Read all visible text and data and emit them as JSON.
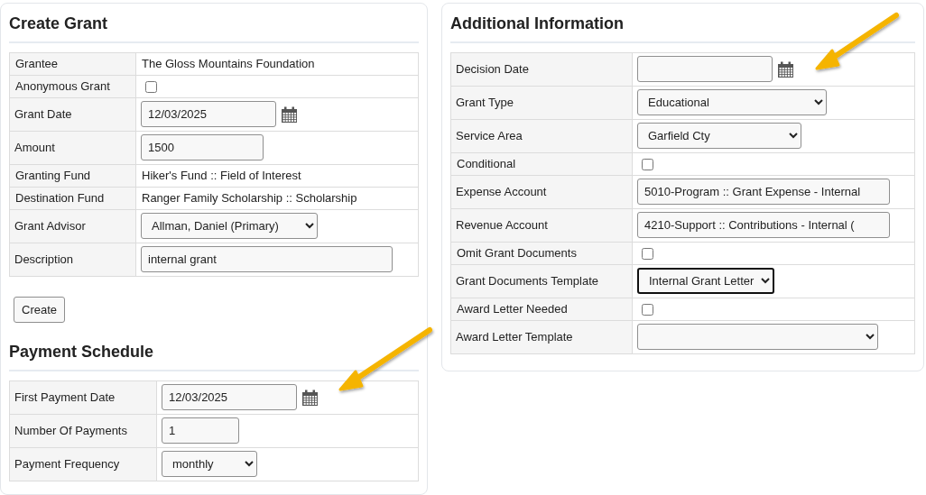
{
  "create_grant": {
    "title": "Create Grant",
    "rows": [
      {
        "label": "Grantee",
        "kind": "text",
        "value": "The Gloss Mountains Foundation"
      },
      {
        "label": "Anonymous Grant",
        "kind": "checkbox",
        "checked": false
      },
      {
        "label": "Grant Date",
        "kind": "date",
        "value": "12/03/2025"
      },
      {
        "label": "Amount",
        "kind": "input",
        "value": "1500"
      },
      {
        "label": "Granting Fund",
        "kind": "text",
        "value": "Hiker's Fund :: Field of Interest"
      },
      {
        "label": "Destination Fund",
        "kind": "text",
        "value": "Ranger Family Scholarship :: Scholarship"
      },
      {
        "label": "Grant Advisor",
        "kind": "select",
        "value": "Allman, Daniel (Primary)"
      },
      {
        "label": "Description",
        "kind": "input",
        "value": "internal grant"
      }
    ],
    "button": "Create"
  },
  "payment_schedule": {
    "title": "Payment Schedule",
    "rows": [
      {
        "label": "First Payment Date",
        "kind": "date",
        "value": "12/03/2025"
      },
      {
        "label": "Number Of Payments",
        "kind": "input",
        "value": "1"
      },
      {
        "label": "Payment Frequency",
        "kind": "select",
        "value": "monthly"
      }
    ]
  },
  "additional_information": {
    "title": "Additional Information",
    "rows": [
      {
        "label": "Decision Date",
        "kind": "date"
      },
      {
        "label": "Grant Type",
        "kind": "select",
        "value": "Educational",
        "focused": false
      },
      {
        "label": "Service Area",
        "kind": "select",
        "value": "Garfield Cty",
        "focused": false
      },
      {
        "label": "Conditional",
        "kind": "checkbox",
        "checked": false
      },
      {
        "label": "Expense Account",
        "kind": "input",
        "value": "5010-Program :: Grant Expense - Internal"
      },
      {
        "label": "Revenue Account",
        "kind": "input",
        "value": "4210-Support :: Contributions - Internal ("
      },
      {
        "label": "Omit Grant Documents",
        "kind": "checkbox",
        "checked": false
      },
      {
        "label": "Grant Documents Template",
        "kind": "select",
        "value": "Internal Grant Letter",
        "focused": true
      },
      {
        "label": "Award Letter Needed",
        "kind": "checkbox",
        "checked": false
      },
      {
        "label": "Award Letter Template",
        "kind": "select",
        "focused": false
      }
    ]
  }
}
